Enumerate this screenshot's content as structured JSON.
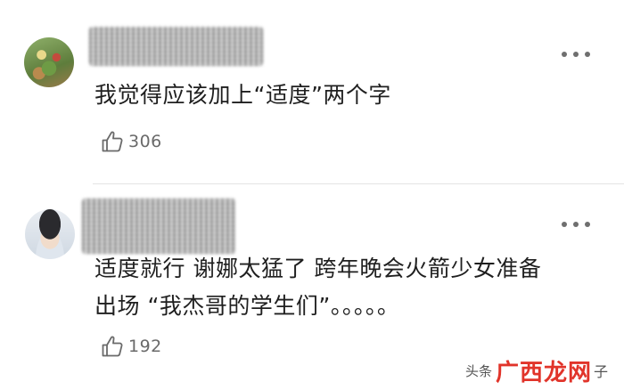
{
  "comments": [
    {
      "text": "我觉得应该加上“适度”两个字",
      "likes": "306"
    },
    {
      "text": "适度就行 谢娜太猛了 跨年晚会火箭少女准备\n出场 “我杰哥的学生们”。。。。。",
      "likes": "192"
    }
  ],
  "watermark": {
    "source": "头条",
    "site": "广西龙网",
    "tail": "子"
  },
  "icons": {
    "more": "more-dots-icon",
    "like": "thumb-up-icon"
  }
}
